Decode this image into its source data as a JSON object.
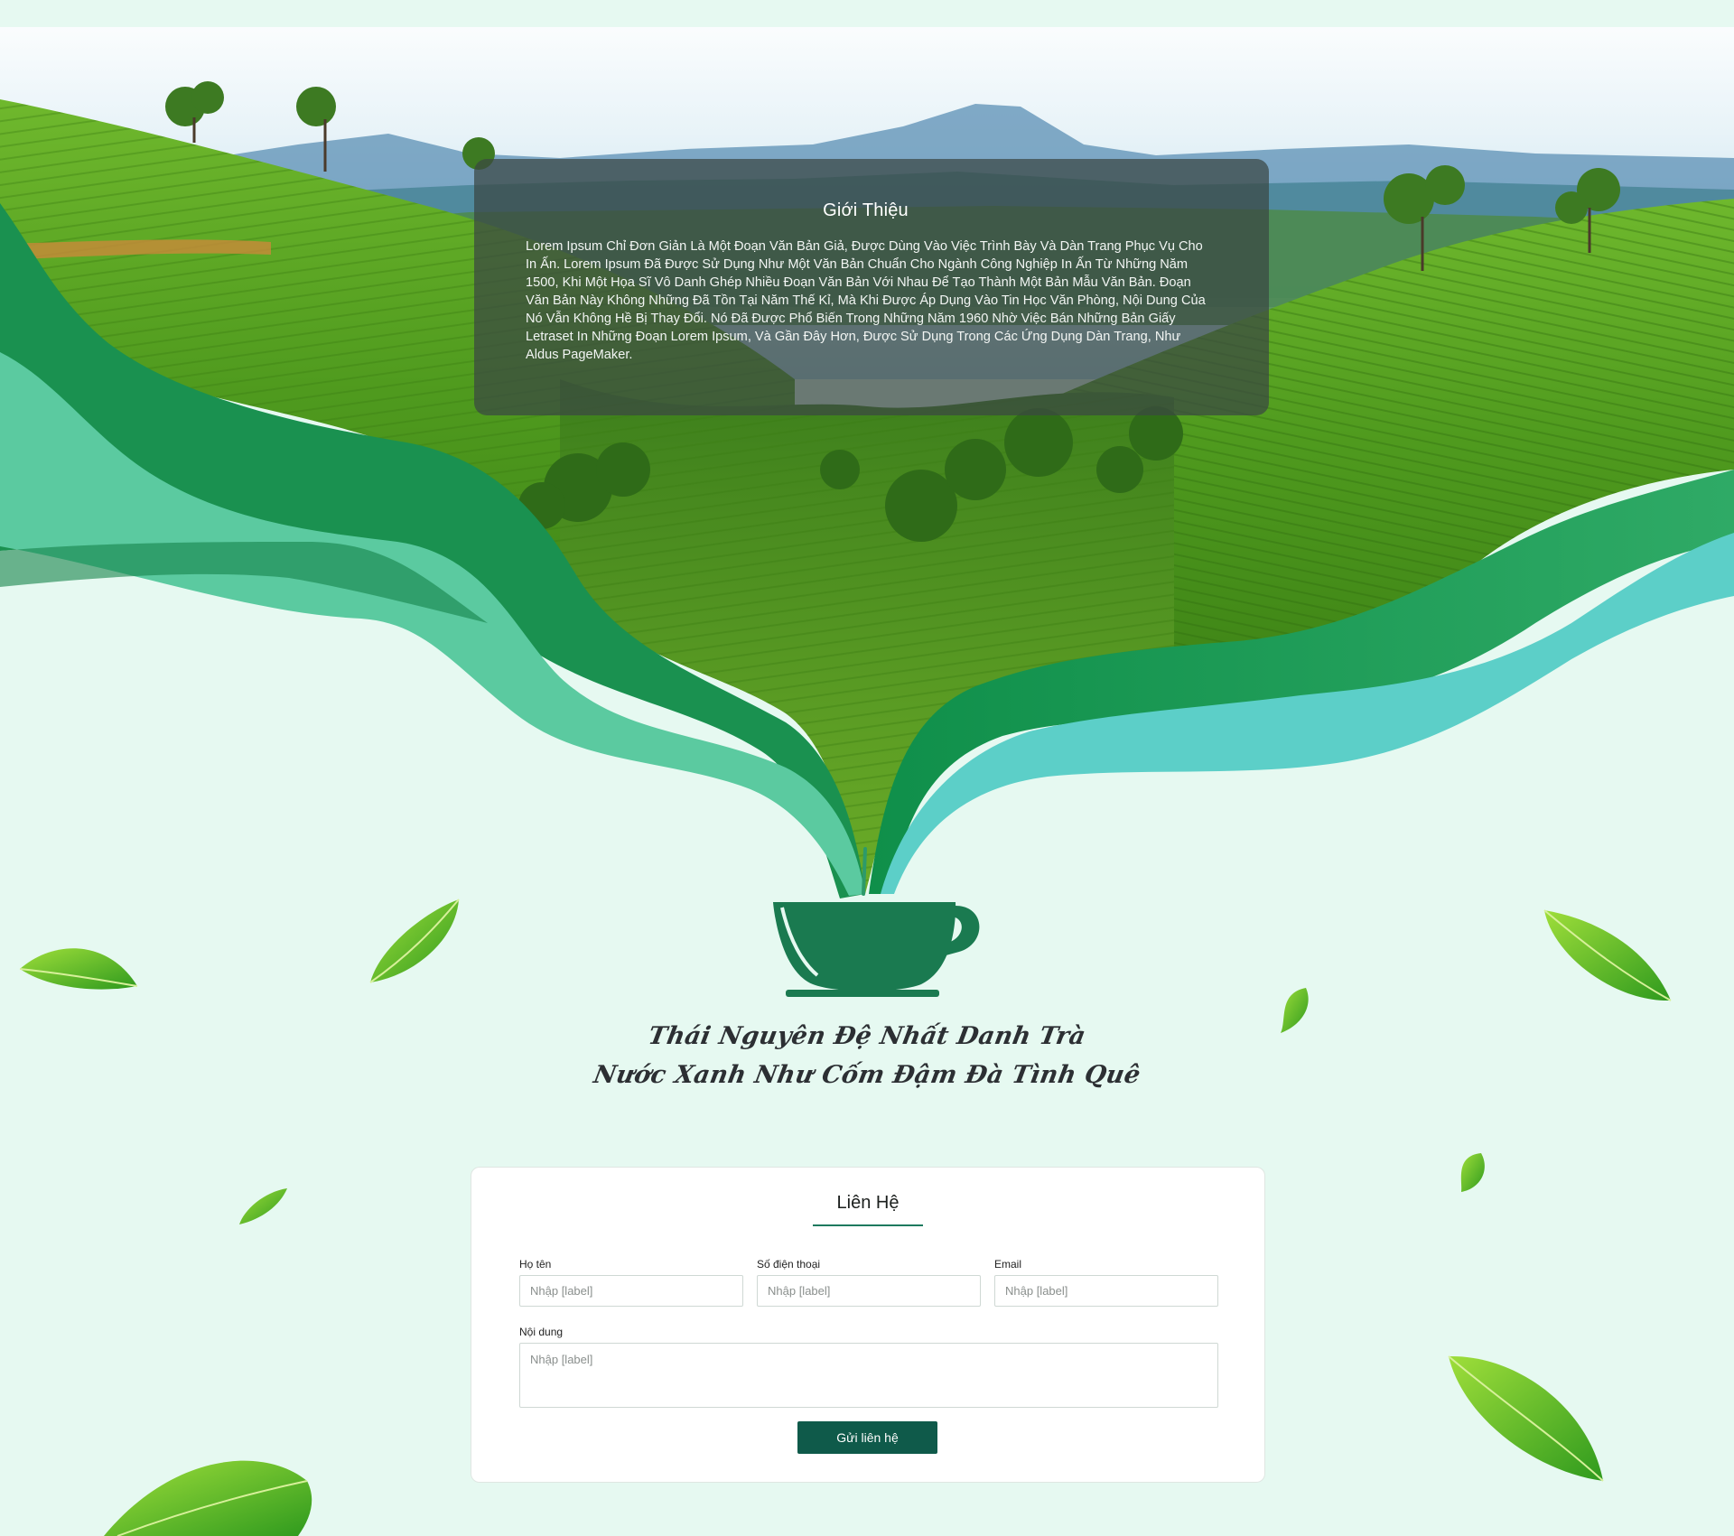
{
  "intro": {
    "title": "Giới Thiệu",
    "body": "Lorem Ipsum Chỉ Đơn Giản Là Một Đoạn Văn Bản Giả, Được Dùng Vào Việc Trình Bày Và Dàn Trang Phục Vụ Cho In Ấn. Lorem Ipsum Đã Được Sử Dụng Như Một Văn Bản Chuẩn Cho Ngành Công Nghiệp In Ấn Từ Những Năm 1500, Khi Một Họa Sĩ Vô Danh Ghép Nhiều Đoạn Văn Bản Với Nhau Để Tạo Thành Một Bản Mẫu Văn Bản. Đoạn Văn Bản Này Không Những Đã Tồn Tại Năm Thế Kỉ, Mà Khi Được Áp Dụng Vào Tin Học Văn Phòng, Nội Dung Của Nó Vẫn Không Hề Bị Thay Đổi. Nó Đã Được Phổ Biến Trong Những Năm 1960 Nhờ Việc Bán Những Bản Giấy Letraset In Những Đoạn Lorem Ipsum, Và Gần Đây Hơn, Được Sử Dụng Trong Các Ứng Dụng Dàn Trang, Như Aldus PageMaker."
  },
  "slogan": {
    "line1": "Thái Nguyên Đệ Nhất Danh Trà",
    "line2": "Nước Xanh Như Cốm Đậm Đà Tình Quê"
  },
  "contact": {
    "title": "Liên Hệ",
    "fields": {
      "name_label": "Họ tên",
      "name_placeholder": "Nhập [label]",
      "phone_label": "Số điện thoại",
      "phone_placeholder": "Nhập [label]",
      "email_label": "Email",
      "email_placeholder": "Nhập [label]",
      "message_label": "Nội dung",
      "message_placeholder": "Nhập [label]"
    },
    "submit_label": "Gửi liên hệ"
  },
  "colors": {
    "page_background": "#e6f9f1",
    "brand_dark_green": "#0f5a4a",
    "wave_dark_green": "#1e9a55",
    "wave_light_green": "#56c99b",
    "wave_teal": "#5ccfc8",
    "cup_green": "#1a7a50"
  },
  "icons": {
    "cup": "tea-cup-icon",
    "leaf": "tea-leaf-icon"
  }
}
